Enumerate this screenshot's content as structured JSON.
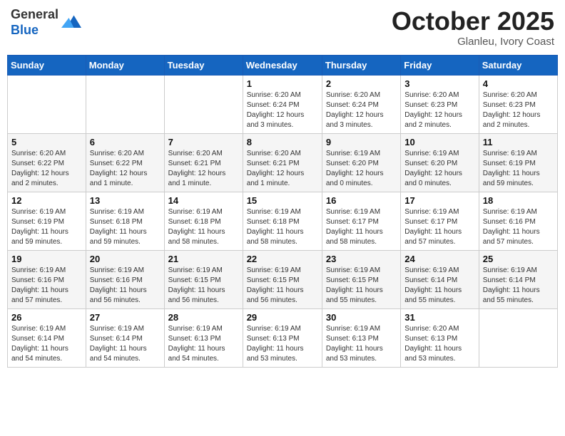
{
  "header": {
    "logo_general": "General",
    "logo_blue": "Blue",
    "month": "October 2025",
    "location": "Glanleu, Ivory Coast"
  },
  "days_of_week": [
    "Sunday",
    "Monday",
    "Tuesday",
    "Wednesday",
    "Thursday",
    "Friday",
    "Saturday"
  ],
  "weeks": [
    [
      {
        "day": "",
        "info": ""
      },
      {
        "day": "",
        "info": ""
      },
      {
        "day": "",
        "info": ""
      },
      {
        "day": "1",
        "info": "Sunrise: 6:20 AM\nSunset: 6:24 PM\nDaylight: 12 hours\nand 3 minutes."
      },
      {
        "day": "2",
        "info": "Sunrise: 6:20 AM\nSunset: 6:24 PM\nDaylight: 12 hours\nand 3 minutes."
      },
      {
        "day": "3",
        "info": "Sunrise: 6:20 AM\nSunset: 6:23 PM\nDaylight: 12 hours\nand 2 minutes."
      },
      {
        "day": "4",
        "info": "Sunrise: 6:20 AM\nSunset: 6:23 PM\nDaylight: 12 hours\nand 2 minutes."
      }
    ],
    [
      {
        "day": "5",
        "info": "Sunrise: 6:20 AM\nSunset: 6:22 PM\nDaylight: 12 hours\nand 2 minutes."
      },
      {
        "day": "6",
        "info": "Sunrise: 6:20 AM\nSunset: 6:22 PM\nDaylight: 12 hours\nand 1 minute."
      },
      {
        "day": "7",
        "info": "Sunrise: 6:20 AM\nSunset: 6:21 PM\nDaylight: 12 hours\nand 1 minute."
      },
      {
        "day": "8",
        "info": "Sunrise: 6:20 AM\nSunset: 6:21 PM\nDaylight: 12 hours\nand 1 minute."
      },
      {
        "day": "9",
        "info": "Sunrise: 6:19 AM\nSunset: 6:20 PM\nDaylight: 12 hours\nand 0 minutes."
      },
      {
        "day": "10",
        "info": "Sunrise: 6:19 AM\nSunset: 6:20 PM\nDaylight: 12 hours\nand 0 minutes."
      },
      {
        "day": "11",
        "info": "Sunrise: 6:19 AM\nSunset: 6:19 PM\nDaylight: 11 hours\nand 59 minutes."
      }
    ],
    [
      {
        "day": "12",
        "info": "Sunrise: 6:19 AM\nSunset: 6:19 PM\nDaylight: 11 hours\nand 59 minutes."
      },
      {
        "day": "13",
        "info": "Sunrise: 6:19 AM\nSunset: 6:18 PM\nDaylight: 11 hours\nand 59 minutes."
      },
      {
        "day": "14",
        "info": "Sunrise: 6:19 AM\nSunset: 6:18 PM\nDaylight: 11 hours\nand 58 minutes."
      },
      {
        "day": "15",
        "info": "Sunrise: 6:19 AM\nSunset: 6:18 PM\nDaylight: 11 hours\nand 58 minutes."
      },
      {
        "day": "16",
        "info": "Sunrise: 6:19 AM\nSunset: 6:17 PM\nDaylight: 11 hours\nand 58 minutes."
      },
      {
        "day": "17",
        "info": "Sunrise: 6:19 AM\nSunset: 6:17 PM\nDaylight: 11 hours\nand 57 minutes."
      },
      {
        "day": "18",
        "info": "Sunrise: 6:19 AM\nSunset: 6:16 PM\nDaylight: 11 hours\nand 57 minutes."
      }
    ],
    [
      {
        "day": "19",
        "info": "Sunrise: 6:19 AM\nSunset: 6:16 PM\nDaylight: 11 hours\nand 57 minutes."
      },
      {
        "day": "20",
        "info": "Sunrise: 6:19 AM\nSunset: 6:16 PM\nDaylight: 11 hours\nand 56 minutes."
      },
      {
        "day": "21",
        "info": "Sunrise: 6:19 AM\nSunset: 6:15 PM\nDaylight: 11 hours\nand 56 minutes."
      },
      {
        "day": "22",
        "info": "Sunrise: 6:19 AM\nSunset: 6:15 PM\nDaylight: 11 hours\nand 56 minutes."
      },
      {
        "day": "23",
        "info": "Sunrise: 6:19 AM\nSunset: 6:15 PM\nDaylight: 11 hours\nand 55 minutes."
      },
      {
        "day": "24",
        "info": "Sunrise: 6:19 AM\nSunset: 6:14 PM\nDaylight: 11 hours\nand 55 minutes."
      },
      {
        "day": "25",
        "info": "Sunrise: 6:19 AM\nSunset: 6:14 PM\nDaylight: 11 hours\nand 55 minutes."
      }
    ],
    [
      {
        "day": "26",
        "info": "Sunrise: 6:19 AM\nSunset: 6:14 PM\nDaylight: 11 hours\nand 54 minutes."
      },
      {
        "day": "27",
        "info": "Sunrise: 6:19 AM\nSunset: 6:14 PM\nDaylight: 11 hours\nand 54 minutes."
      },
      {
        "day": "28",
        "info": "Sunrise: 6:19 AM\nSunset: 6:13 PM\nDaylight: 11 hours\nand 54 minutes."
      },
      {
        "day": "29",
        "info": "Sunrise: 6:19 AM\nSunset: 6:13 PM\nDaylight: 11 hours\nand 53 minutes."
      },
      {
        "day": "30",
        "info": "Sunrise: 6:19 AM\nSunset: 6:13 PM\nDaylight: 11 hours\nand 53 minutes."
      },
      {
        "day": "31",
        "info": "Sunrise: 6:20 AM\nSunset: 6:13 PM\nDaylight: 11 hours\nand 53 minutes."
      },
      {
        "day": "",
        "info": ""
      }
    ]
  ]
}
